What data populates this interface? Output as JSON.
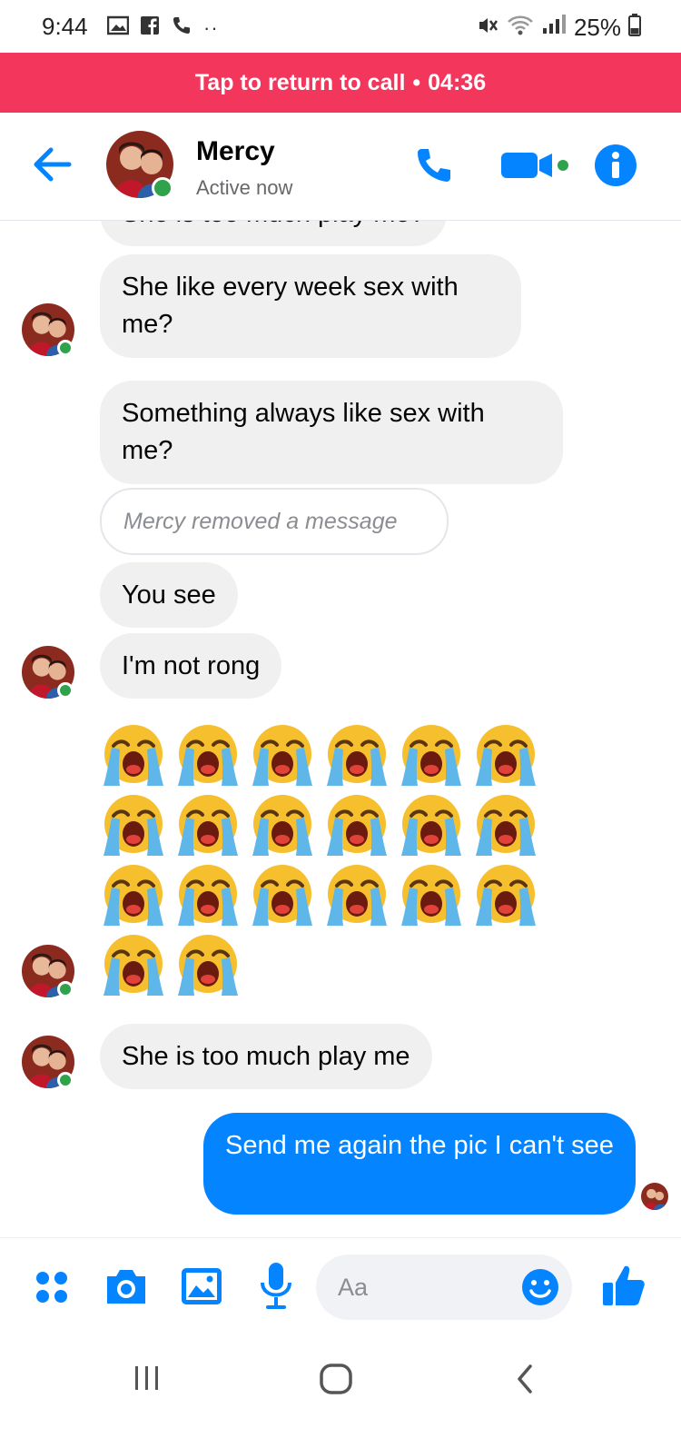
{
  "status_bar": {
    "time": "9:44",
    "battery": "25%",
    "left_icons": [
      "gallery-icon",
      "facebook-icon",
      "phone-icon",
      "more-dots-icon"
    ],
    "right_icons": [
      "mute-icon",
      "wifi-icon",
      "signal-icon",
      "battery-icon"
    ]
  },
  "call_banner": {
    "text": "Tap to return to call",
    "separator": "•",
    "duration": "04:36",
    "color": "#f2365c"
  },
  "header": {
    "contact_name": "Mercy",
    "status": "Active now",
    "icons": [
      "back-arrow-icon",
      "phone-icon",
      "video-camera-icon",
      "info-icon"
    ],
    "accent": "#0584ff"
  },
  "messages": {
    "partial_top": "She is too much play me?",
    "m1": "She like every week sex with me?",
    "m2": "Something always like sex with me?",
    "removed": "Mercy removed a message",
    "m3": "You see",
    "m4": "I'm not rong",
    "emoji_count": 20,
    "emoji_name": "loudly-crying-face",
    "m5": "She is too much play me",
    "sent": "Send me again the pic I can't see"
  },
  "composer": {
    "placeholder": "Aa",
    "icons": [
      "apps-icon",
      "camera-icon",
      "gallery-icon",
      "microphone-icon",
      "emoji-icon",
      "thumbs-up-icon"
    ]
  },
  "nav_bar": {
    "icons": [
      "recent-apps-icon",
      "home-icon",
      "back-icon"
    ]
  }
}
